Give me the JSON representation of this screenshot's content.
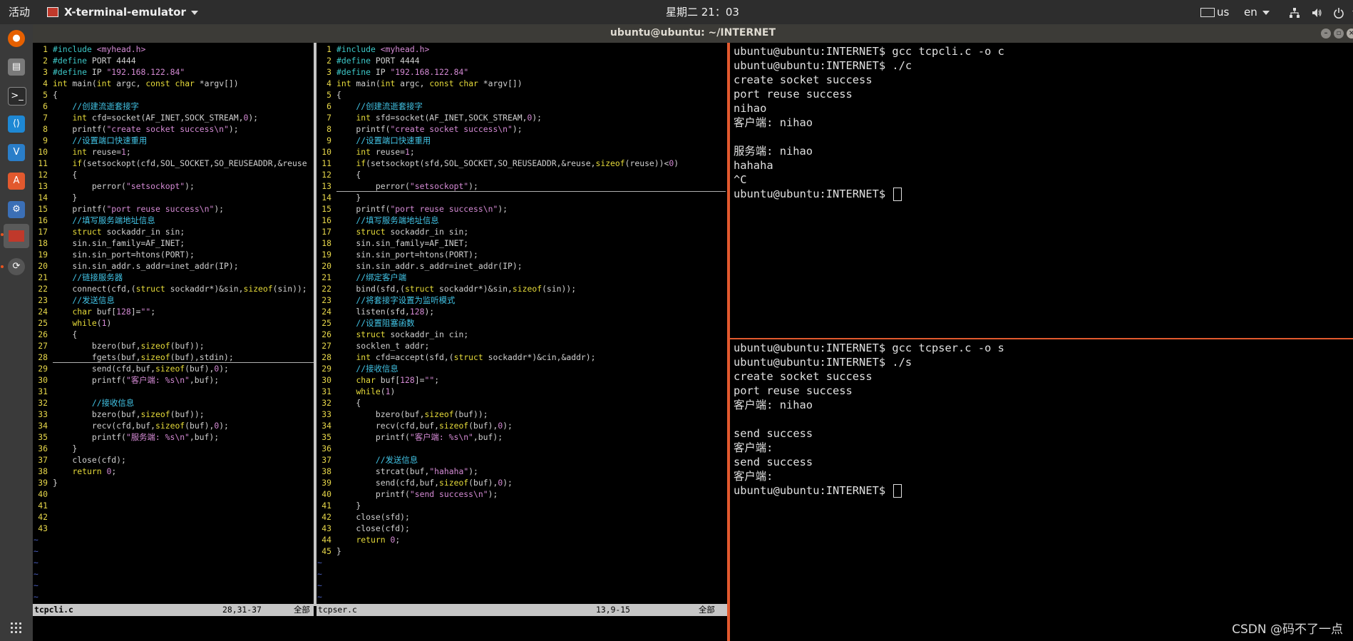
{
  "topbar": {
    "activities": "活动",
    "app_name": "X-terminal-emulator",
    "clock": "星期二 21：03",
    "keyboard": "us",
    "language": "en"
  },
  "window": {
    "title": "ubuntu@ubuntu: ~/INTERNET"
  },
  "colors": {
    "keyword": "#e6db3a",
    "string": "#d48ad4",
    "comment": "#42c4e6",
    "line_number": "#e8d84a",
    "divider": "#e2592e"
  },
  "dock": {
    "icons": [
      "firefox-icon",
      "files-icon",
      "terminal-icon",
      "vscode-icon",
      "vmware-icon",
      "software-center-icon",
      "settings-icon",
      "terminal-emulator-icon",
      "updater-icon"
    ]
  },
  "vim_left": {
    "filename": "tcpcli.c",
    "position": "28,31-37",
    "scroll": "全部",
    "lines": [
      "#include <myhead.h>",
      "#define PORT 4444",
      "#define IP \"192.168.122.84\"",
      "int main(int argc, const char *argv[])",
      "{",
      "    //创建流逝套接字",
      "    int cfd=socket(AF_INET,SOCK_STREAM,0);",
      "    printf(\"create socket success\\n\");",
      "    //设置端口快速重用",
      "    int reuse=1;",
      "    if(setsockopt(cfd,SOL_SOCKET,SO_REUSEADDR,&reuse",
      "    {",
      "        perror(\"setsockopt\");",
      "    }",
      "    printf(\"port reuse success\\n\");",
      "    //填写服务端地址信息",
      "    struct sockaddr_in sin;",
      "    sin.sin_family=AF_INET;",
      "    sin.sin_port=htons(PORT);",
      "    sin.sin_addr.s_addr=inet_addr(IP);",
      "    //链接服务器",
      "    connect(cfd,(struct sockaddr*)&sin,sizeof(sin));",
      "    //发送信息",
      "    char buf[128]=\"\";",
      "    while(1)",
      "    {",
      "        bzero(buf,sizeof(buf));",
      "        fgets(buf,sizeof(buf),stdin);",
      "        send(cfd,buf,sizeof(buf),0);",
      "        printf(\"客户端: %s\\n\",buf);",
      "",
      "        //接收信息",
      "        bzero(buf,sizeof(buf));",
      "        recv(cfd,buf,sizeof(buf),0);",
      "        printf(\"服务端: %s\\n\",buf);",
      "    }",
      "    close(cfd);",
      "    return 0;",
      "}",
      "",
      "",
      "",
      ""
    ],
    "tildes": 6
  },
  "vim_right": {
    "filename": "tcpser.c",
    "position": "13,9-15",
    "scroll": "全部",
    "lines": [
      "#include <myhead.h>",
      "#define PORT 4444",
      "#define IP \"192.168.122.84\"",
      "int main(int argc, const char *argv[])",
      "{",
      "    //创建流逝套接字",
      "    int sfd=socket(AF_INET,SOCK_STREAM,0);",
      "    printf(\"create socket success\\n\");",
      "    //设置端口快速重用",
      "    int reuse=1;",
      "    if(setsockopt(sfd,SOL_SOCKET,SO_REUSEADDR,&reuse,sizeof(reuse))<0)",
      "    {",
      "        perror(\"setsockopt\");",
      "    }",
      "    printf(\"port reuse success\\n\");",
      "    //填写服务端地址信息",
      "    struct sockaddr_in sin;",
      "    sin.sin_family=AF_INET;",
      "    sin.sin_port=htons(PORT);",
      "    sin.sin_addr.s_addr=inet_addr(IP);",
      "    //绑定客户端",
      "    bind(sfd,(struct sockaddr*)&sin,sizeof(sin));",
      "    //将套接字设置为监听模式",
      "    listen(sfd,128);",
      "    //设置阻塞函数",
      "    struct sockaddr_in cin;",
      "    socklen_t addr;",
      "    int cfd=accept(sfd,(struct sockaddr*)&cin,&addr);",
      "    //接收信息",
      "    char buf[128]=\"\";",
      "    while(1)",
      "    {",
      "        bzero(buf,sizeof(buf));",
      "        recv(cfd,buf,sizeof(buf),0);",
      "        printf(\"客户端: %s\\n\",buf);",
      "",
      "        //发送信息",
      "        strcat(buf,\"hahaha\");",
      "        send(cfd,buf,sizeof(buf),0);",
      "        printf(\"send success\\n\");",
      "    }",
      "    close(sfd);",
      "    close(cfd);",
      "    return 0;",
      "}"
    ],
    "tildes": 4
  },
  "terminal_client": {
    "lines": [
      "ubuntu@ubuntu:INTERNET$ gcc tcpcli.c -o c",
      "ubuntu@ubuntu:INTERNET$ ./c",
      "create socket success",
      "port reuse success",
      "nihao",
      "客户端: nihao",
      "",
      "服务端: nihao",
      "hahaha",
      "^C",
      "ubuntu@ubuntu:INTERNET$ "
    ]
  },
  "terminal_server": {
    "lines": [
      "ubuntu@ubuntu:INTERNET$ gcc tcpser.c -o s",
      "ubuntu@ubuntu:INTERNET$ ./s",
      "create socket success",
      "port reuse success",
      "客户端: nihao",
      "",
      "send success",
      "客户端:",
      "send success",
      "客户端:",
      "ubuntu@ubuntu:INTERNET$ "
    ]
  },
  "watermark": "CSDN @码不了一点"
}
